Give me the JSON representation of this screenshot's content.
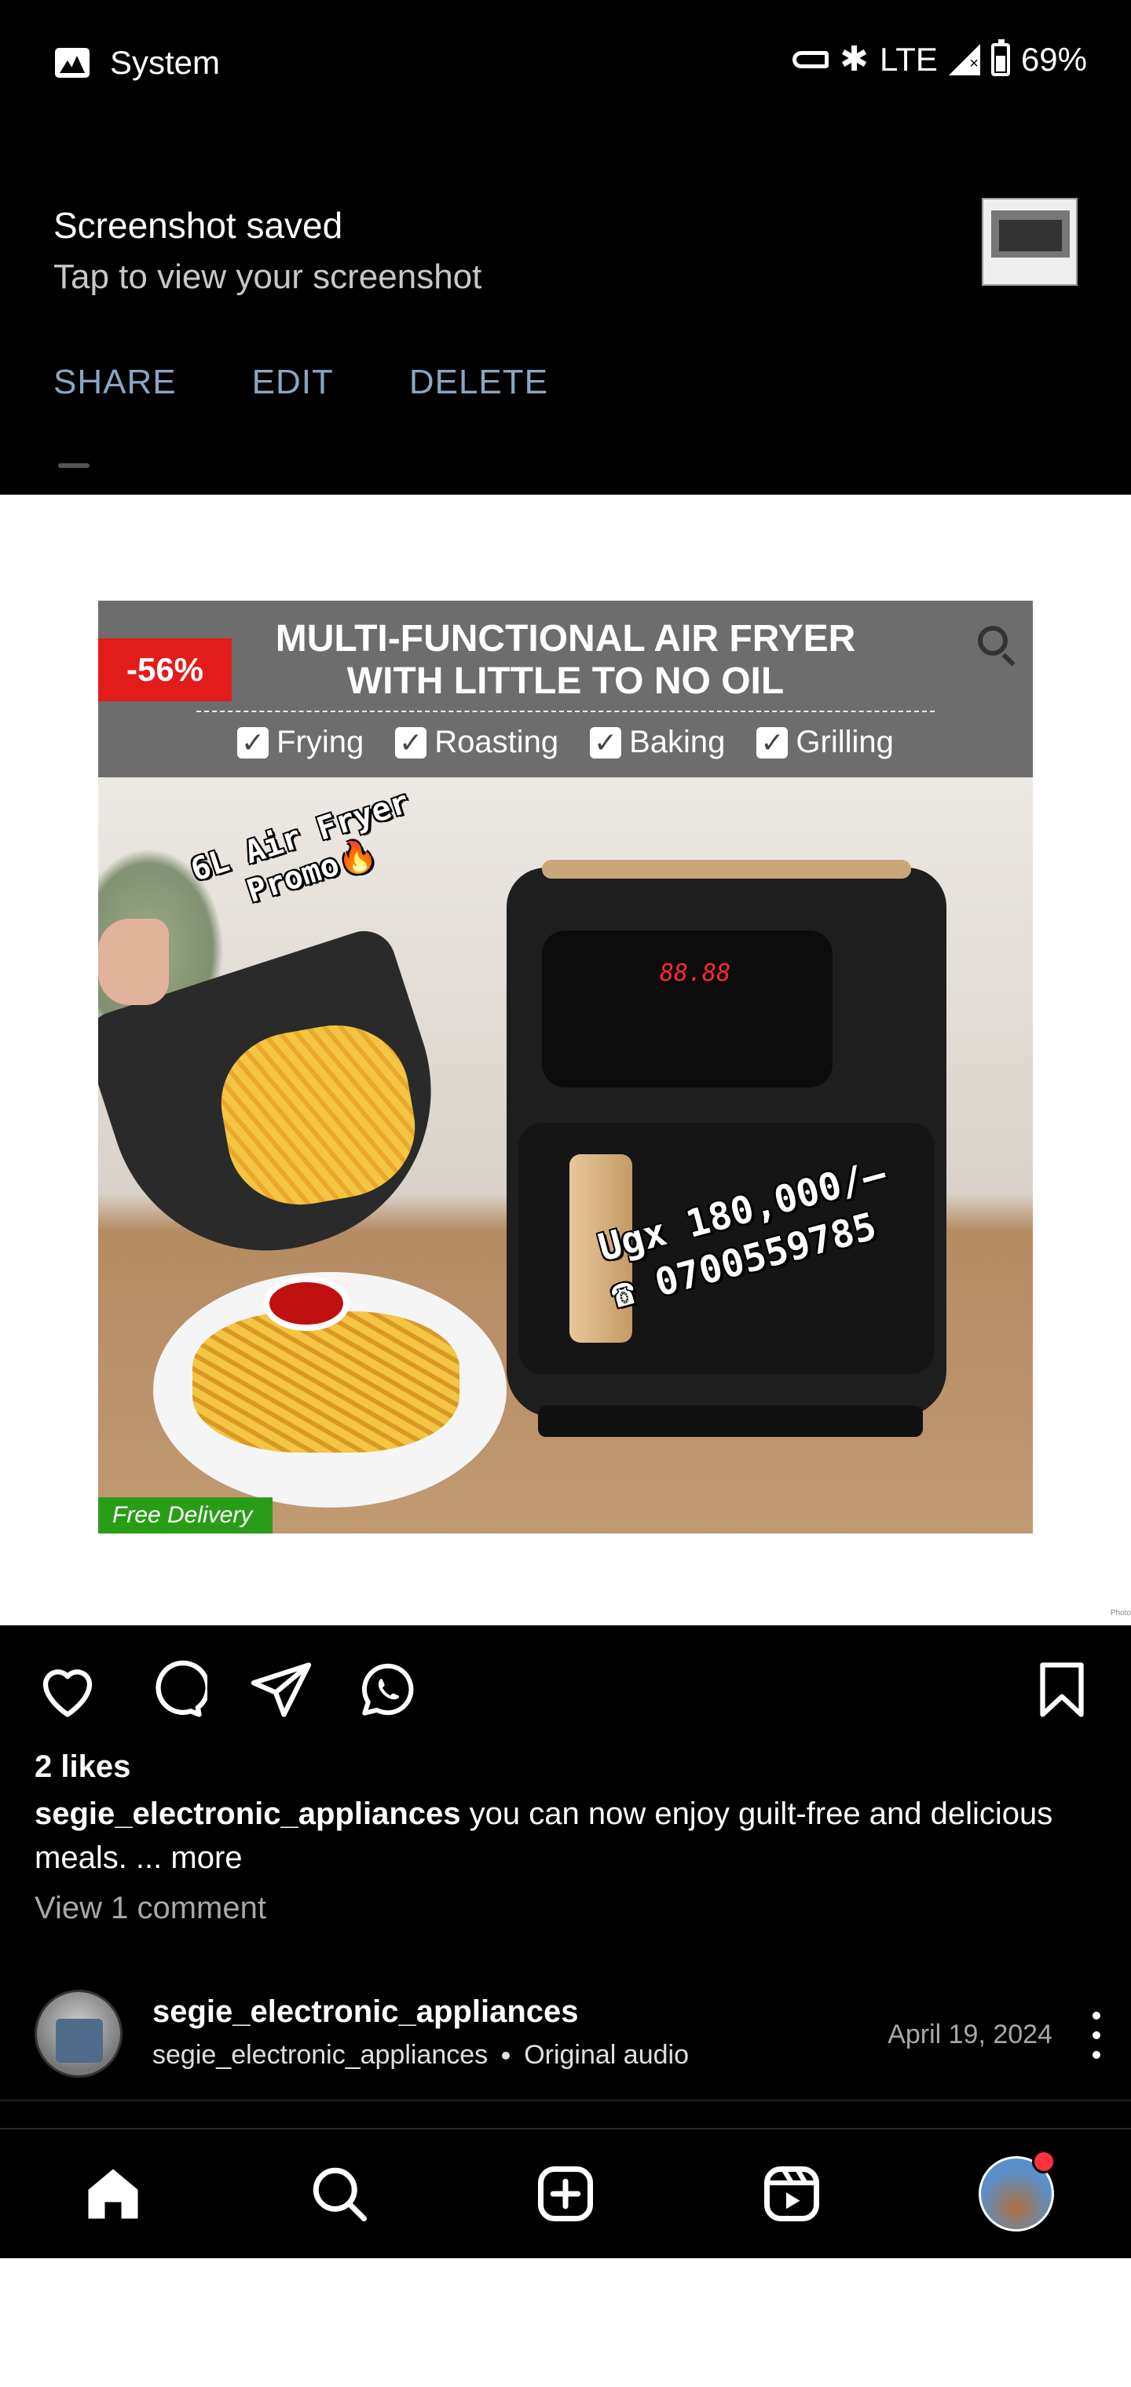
{
  "status_bar": {
    "app_label": "System",
    "network": "LTE",
    "battery": "69%"
  },
  "notification": {
    "title": "Screenshot saved",
    "subtitle": "Tap to view your screenshot",
    "actions": [
      "SHARE",
      "EDIT",
      "DELETE"
    ]
  },
  "ad": {
    "discount": "-56%",
    "title_line1": "MULTI-FUNCTIONAL AIR FRYER",
    "title_line2": "WITH LITTLE TO NO OIL",
    "features": [
      "Frying",
      "Roasting",
      "Baking",
      "Grilling"
    ],
    "promo_line1": "6L Air Fryer",
    "promo_line2": "Promo🔥",
    "price": "Ugx 180,000/–",
    "phone": "☎ 0700559785",
    "display": "88.88",
    "free_delivery": "Free Delivery"
  },
  "post": {
    "likes": "2 likes",
    "caption_user": "segie_electronic_appliances",
    "caption_text": " you can now enjoy guilt-free and delicious meals.",
    "caption_more": " ... more",
    "view_comments": "View 1 comment",
    "author": "segie_electronic_appliances",
    "author_sub": "segie_electronic_appliances",
    "audio": "Original audio",
    "date": "April 19, 2024",
    "photo_tag": "Photo"
  },
  "icons": {
    "like": "heart-icon",
    "comment": "comment-icon",
    "share": "send-icon",
    "whatsapp": "whatsapp-icon",
    "save": "bookmark-icon",
    "nav": [
      "home-icon",
      "search-icon",
      "create-icon",
      "reels-icon",
      "profile-avatar"
    ]
  },
  "colors": {
    "action_blue": "#8aa6c1",
    "badge_red": "#e31b1b",
    "delivery_green": "#2a9d18",
    "notification_dot": "#ff3040"
  }
}
